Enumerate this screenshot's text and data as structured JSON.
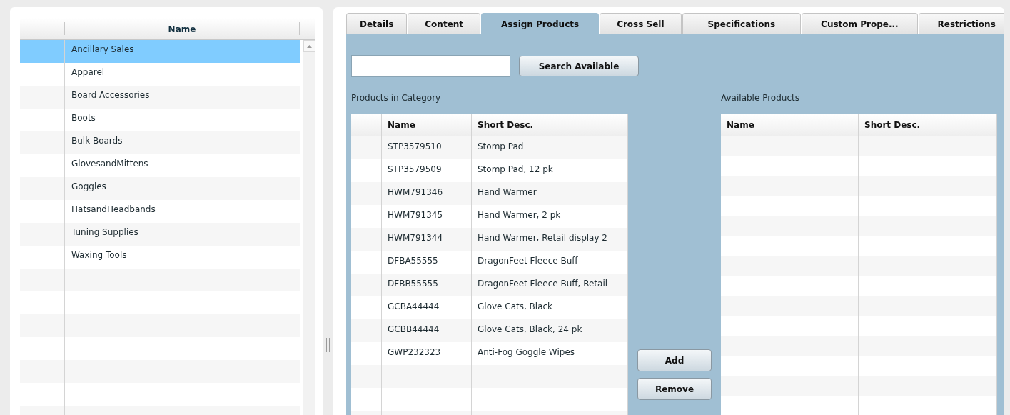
{
  "categories": {
    "header": "Name",
    "items": [
      {
        "name": "Ancillary Sales",
        "selected": true
      },
      {
        "name": "Apparel",
        "selected": false
      },
      {
        "name": "Board Accessories",
        "selected": false
      },
      {
        "name": "Boots",
        "selected": false
      },
      {
        "name": "Bulk Boards",
        "selected": false
      },
      {
        "name": "GlovesandMittens",
        "selected": false
      },
      {
        "name": "Goggles",
        "selected": false
      },
      {
        "name": "HatsandHeadbands",
        "selected": false
      },
      {
        "name": "Tuning Supplies",
        "selected": false
      },
      {
        "name": "Waxing Tools",
        "selected": false
      }
    ]
  },
  "tabs": [
    {
      "label": "Details",
      "selected": false
    },
    {
      "label": "Content",
      "selected": false
    },
    {
      "label": "Assign Products",
      "selected": true
    },
    {
      "label": "Cross Sell",
      "selected": false
    },
    {
      "label": "Specifications",
      "selected": false
    },
    {
      "label": "Custom Prope...",
      "selected": false
    },
    {
      "label": "Restrictions",
      "selected": false
    }
  ],
  "assign": {
    "search_button": "Search Available",
    "in_category": {
      "title": "Products in Category",
      "columns": [
        "Name",
        "Short Desc."
      ],
      "rows": [
        [
          "STP3579510",
          "Stomp Pad"
        ],
        [
          "STP3579509",
          "Stomp Pad, 12 pk"
        ],
        [
          "HWM791346",
          "Hand Warmer"
        ],
        [
          "HWM791345",
          "Hand Warmer, 2 pk"
        ],
        [
          "HWM791344",
          "Hand Warmer, Retail display 2"
        ],
        [
          "DFBA55555",
          "DragonFeet Fleece Buff"
        ],
        [
          "DFBB55555",
          "DragonFeet Fleece Buff, Retail"
        ],
        [
          "GCBA44444",
          "Glove Cats, Black"
        ],
        [
          "GCBB44444",
          "Glove Cats, Black, 24 pk"
        ],
        [
          "GWP232323",
          "Anti-Fog Goggle Wipes"
        ]
      ]
    },
    "buttons": [
      "Add",
      "Remove"
    ],
    "available": {
      "title": "Available Products",
      "columns": [
        "Name",
        "Short Desc."
      ]
    }
  }
}
